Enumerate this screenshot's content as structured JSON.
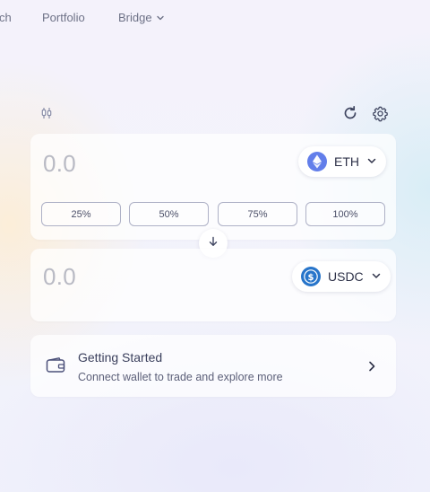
{
  "nav": {
    "items": [
      {
        "label": "ch"
      },
      {
        "label": "Portfolio"
      },
      {
        "label": "Bridge",
        "has_dropdown": true
      }
    ]
  },
  "widget": {
    "toolbar_icons": [
      "chart-candles-icon",
      "refresh-icon",
      "gear-icon"
    ]
  },
  "from_card": {
    "amount": "0.0",
    "token": {
      "symbol": "ETH",
      "icon": "eth-logo-icon",
      "color": "#627EEA"
    },
    "percent_buttons": [
      "25%",
      "50%",
      "75%",
      "100%"
    ]
  },
  "to_card": {
    "amount": "0.0",
    "token": {
      "symbol": "USDC",
      "icon": "usdc-logo-icon",
      "color": "#2775CA"
    }
  },
  "getting_started": {
    "title": "Getting Started",
    "subtitle": "Connect wallet to trade and explore more",
    "icon": "wallet-icon"
  }
}
